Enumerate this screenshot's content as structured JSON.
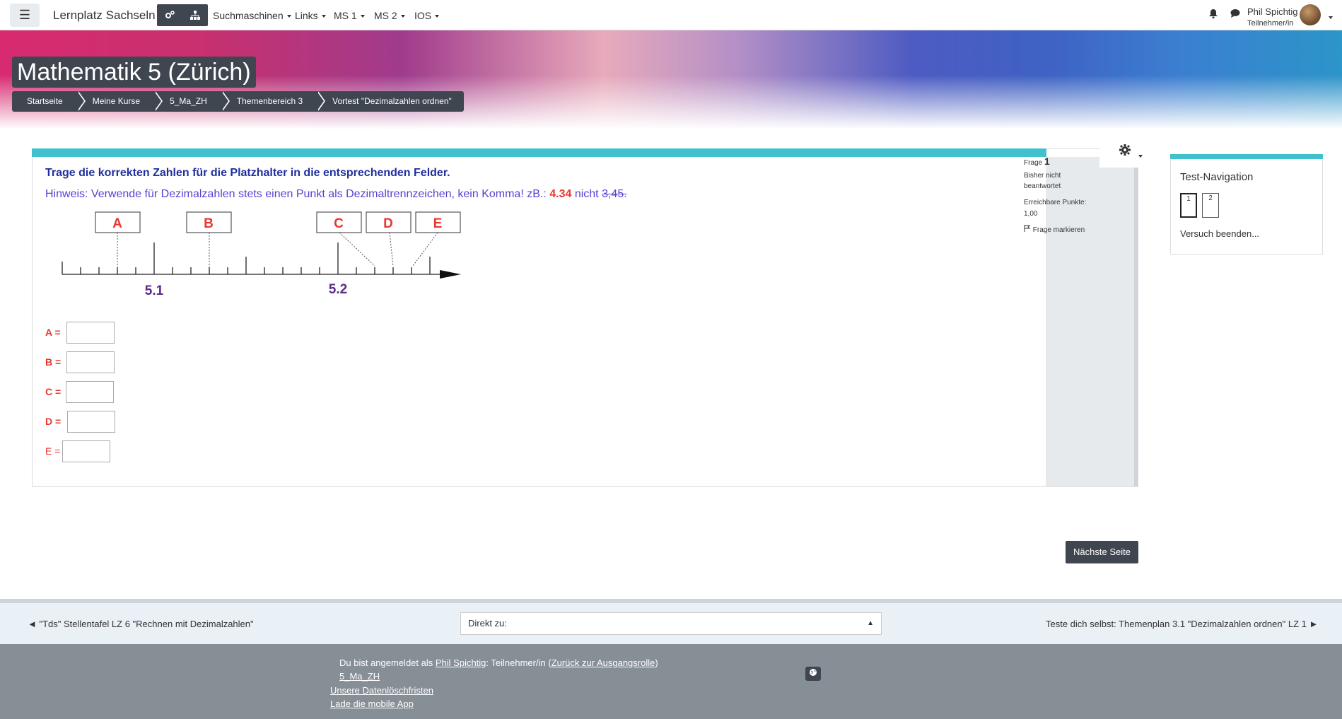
{
  "navbar": {
    "site_name": "Lernplatz Sachseln",
    "menus": [
      "Suchmaschinen",
      "Links",
      "MS 1",
      "MS 2",
      "IOS"
    ],
    "user_name": "Phil Spichtig",
    "user_role": "Teilnehmer/in",
    "icons": [
      "hamburger-icon",
      "cogs-icon",
      "sitemap-icon",
      "bell-icon",
      "chat-icon"
    ]
  },
  "header": {
    "course_title": "Mathematik 5 (Zürich)",
    "breadcrumb": [
      "Startseite",
      "Meine Kurse",
      "5_Ma_ZH",
      "Themenbereich 3",
      "Vortest \"Dezimalzahlen ordnen\""
    ]
  },
  "question": {
    "info_label": "Frage",
    "number": "1",
    "state": "Bisher nicht beantwortet",
    "points_label": "Erreichbare Punkte:",
    "points_value": "1,00",
    "flag_label": "Frage markieren",
    "text": "Trage die korrekten Zahlen für die Platzhalter in die entsprechenden Felder.",
    "hint_prefix": "Hinweis: Verwende für Dezimalzahlen stets einen Punkt als Dezimaltrennzeichen, kein Komma! zB.:",
    "hint_good": "4.34",
    "hint_mid": "nicht",
    "hint_bad": "3,45.",
    "numberline": {
      "boxes": [
        "A",
        "B",
        "C",
        "D",
        "E"
      ],
      "tick_labels": [
        "5.1",
        "5.2"
      ]
    },
    "fields": [
      {
        "label": "A =",
        "value": ""
      },
      {
        "label": "B =",
        "value": ""
      },
      {
        "label": "C =",
        "value": ""
      },
      {
        "label": "D =",
        "value": ""
      },
      {
        "label": "E =",
        "value": ""
      }
    ],
    "next_button": "Nächste Seite"
  },
  "test_navigation": {
    "title": "Test-Navigation",
    "questions": [
      "1",
      "2"
    ],
    "finish": "Versuch beenden..."
  },
  "activity_nav": {
    "prev": "◄ \"Tds\" Stellentafel LZ 6 \"Rechnen mit Dezimalzahlen\"",
    "jump_placeholder": "Direkt zu:",
    "next": "Teste dich selbst: Themenplan 3.1 \"Dezimalzahlen ordnen\" LZ 1 ►"
  },
  "footer": {
    "logged_in_prefix": "Du bist angemeldet als",
    "user_link": "Phil Spichtig",
    "role_part": ": Teilnehmer/in (",
    "return_link": "Zurück zur Ausgangsrolle",
    "role_close": ")",
    "course_link": "5_Ma_ZH",
    "data_link": "Unsere Datenlöschfristen",
    "app_link": "Lade die mobile App"
  }
}
